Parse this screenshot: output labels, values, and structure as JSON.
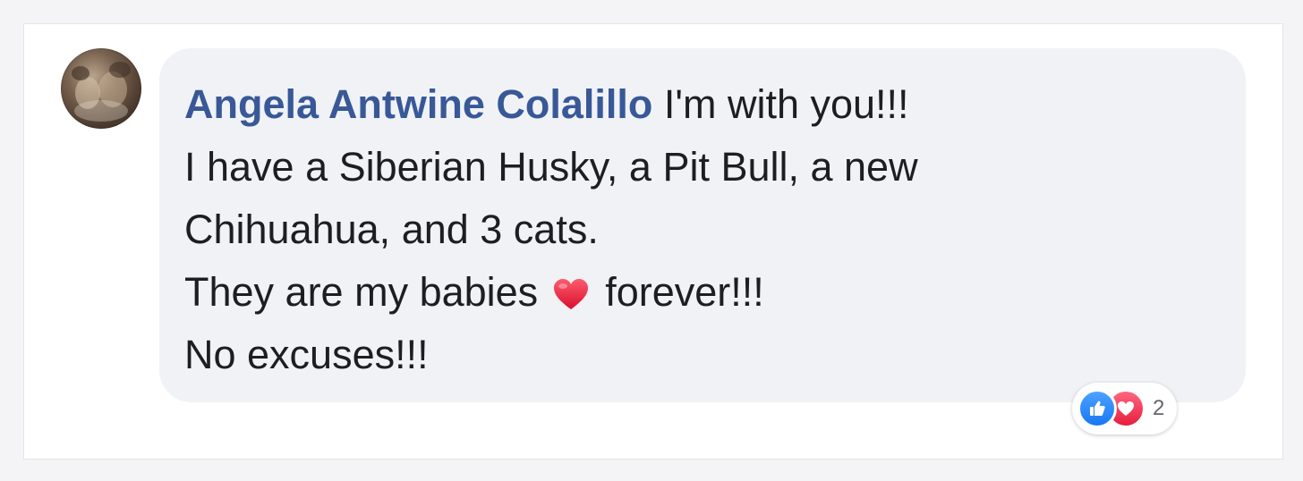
{
  "comment": {
    "author": "Angela Antwine Colalillo",
    "lines": [
      "I'm with you!!!",
      "I have a Siberian Husky, a Pit Bull, a new",
      "Chihuahua, and 3 cats.",
      "They are my babies",
      "forever!!!",
      "No excuses!!!"
    ],
    "emoji": "heart-emoji",
    "reactions": {
      "types": [
        "like-icon",
        "love-icon"
      ],
      "count": "2"
    }
  },
  "colors": {
    "author": "#385898",
    "bubble": "#f0f2f5",
    "text": "#1c1e21",
    "like": "#1877f2",
    "love": "#e61e3d"
  }
}
